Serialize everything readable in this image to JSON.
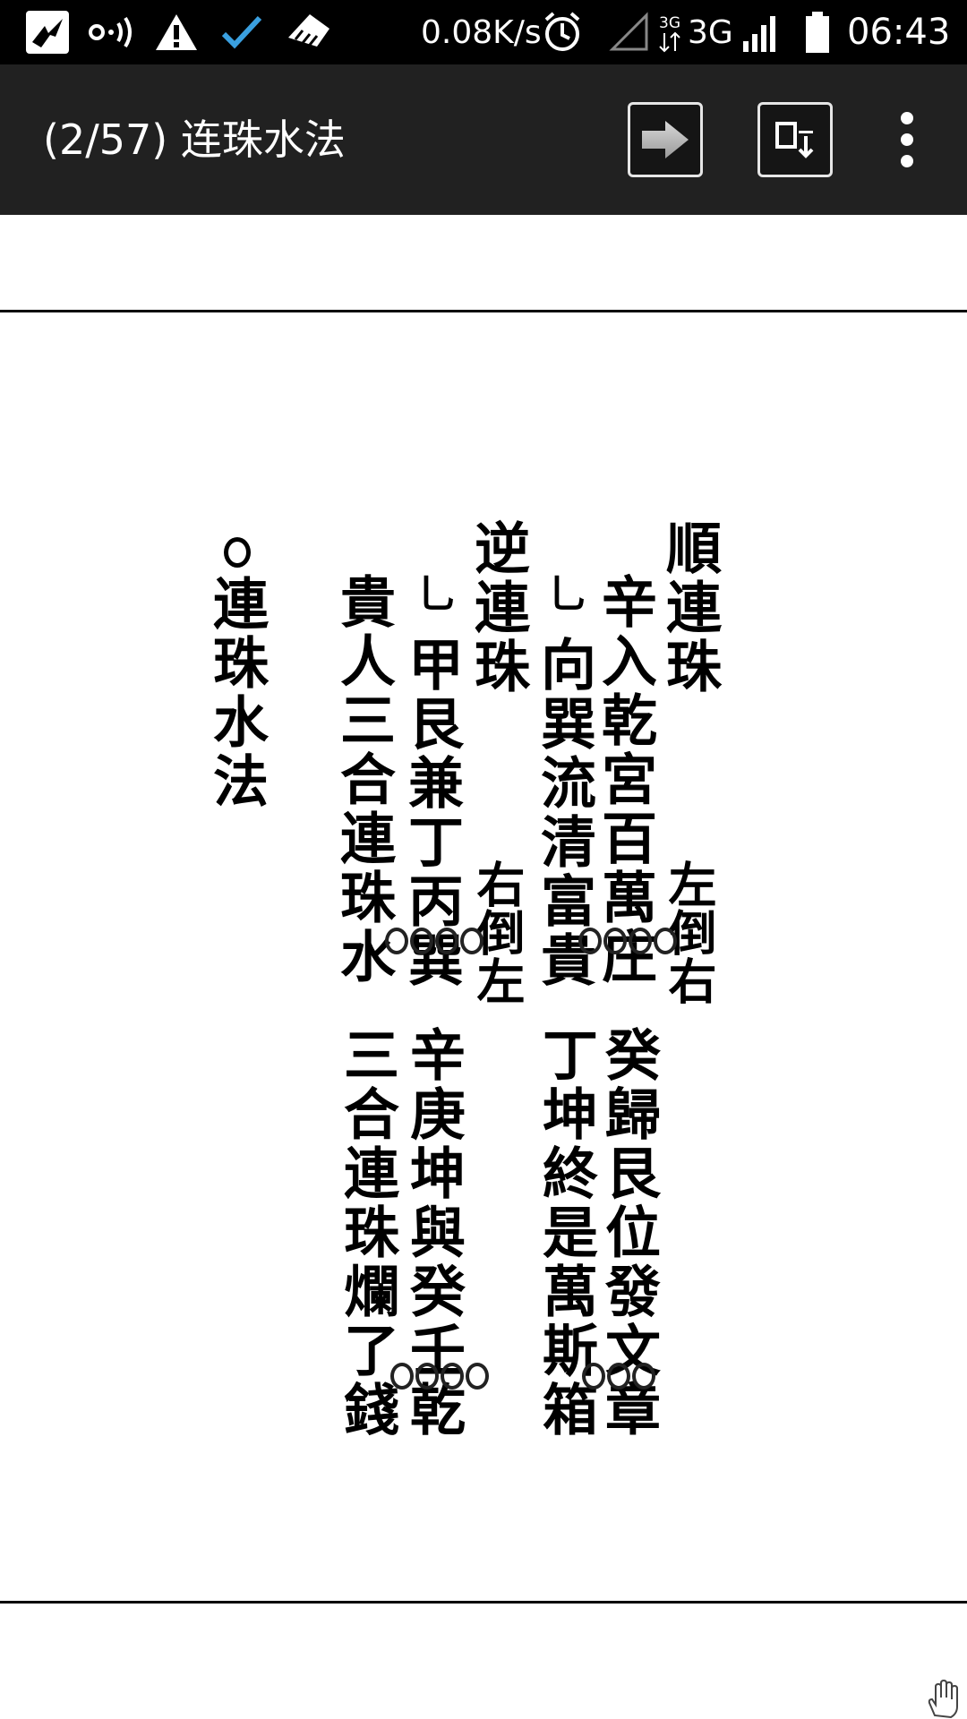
{
  "status_bar": {
    "network_speed": "0.08K/s",
    "network_type": "3G",
    "time": "06:43",
    "icons": [
      "app-bird-icon",
      "hotspot-icon",
      "warning-icon",
      "check-icon",
      "broom-icon",
      "alarm-icon",
      "no-signal-icon",
      "data-3g-icon",
      "signal-icon",
      "battery-icon"
    ]
  },
  "action_bar": {
    "title": "(2/57) 连珠水法",
    "buttons": [
      "next-arrow-icon",
      "download-icon",
      "overflow-menu-icon"
    ]
  },
  "document": {
    "columns": [
      "順連珠",
      "辛入乾宮百萬庄",
      "向巽流清富貴",
      "逆連珠",
      "甲艮兼丁丙巽",
      "貴人三合連珠水",
      "連珠水法",
      "癸歸艮位發文章",
      "丁坤終是萬斯箱",
      "辛庚坤與癸壬乾",
      "三合連珠爛了錢"
    ],
    "annotations": [
      "左倒右",
      "右倒左"
    ]
  }
}
